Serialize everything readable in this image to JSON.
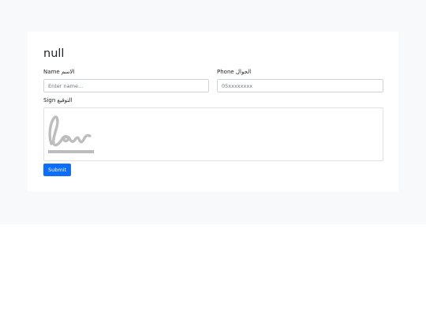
{
  "form": {
    "title": "null",
    "name_label": "Name الاسم",
    "name_placeholder": "Enter name...",
    "name_value": "",
    "phone_label": "Phone الجوال",
    "phone_placeholder": "05xxxxxxxx",
    "phone_value": "",
    "sign_label": "Sign التوقيع",
    "signature_icon": "signature-icon",
    "submit_label": "Submit"
  },
  "colors": {
    "page_background": "#f8f9fa",
    "card_background": "#ffffff",
    "accent": "#0d6efd",
    "signature_placeholder": "#bdbdbd"
  }
}
